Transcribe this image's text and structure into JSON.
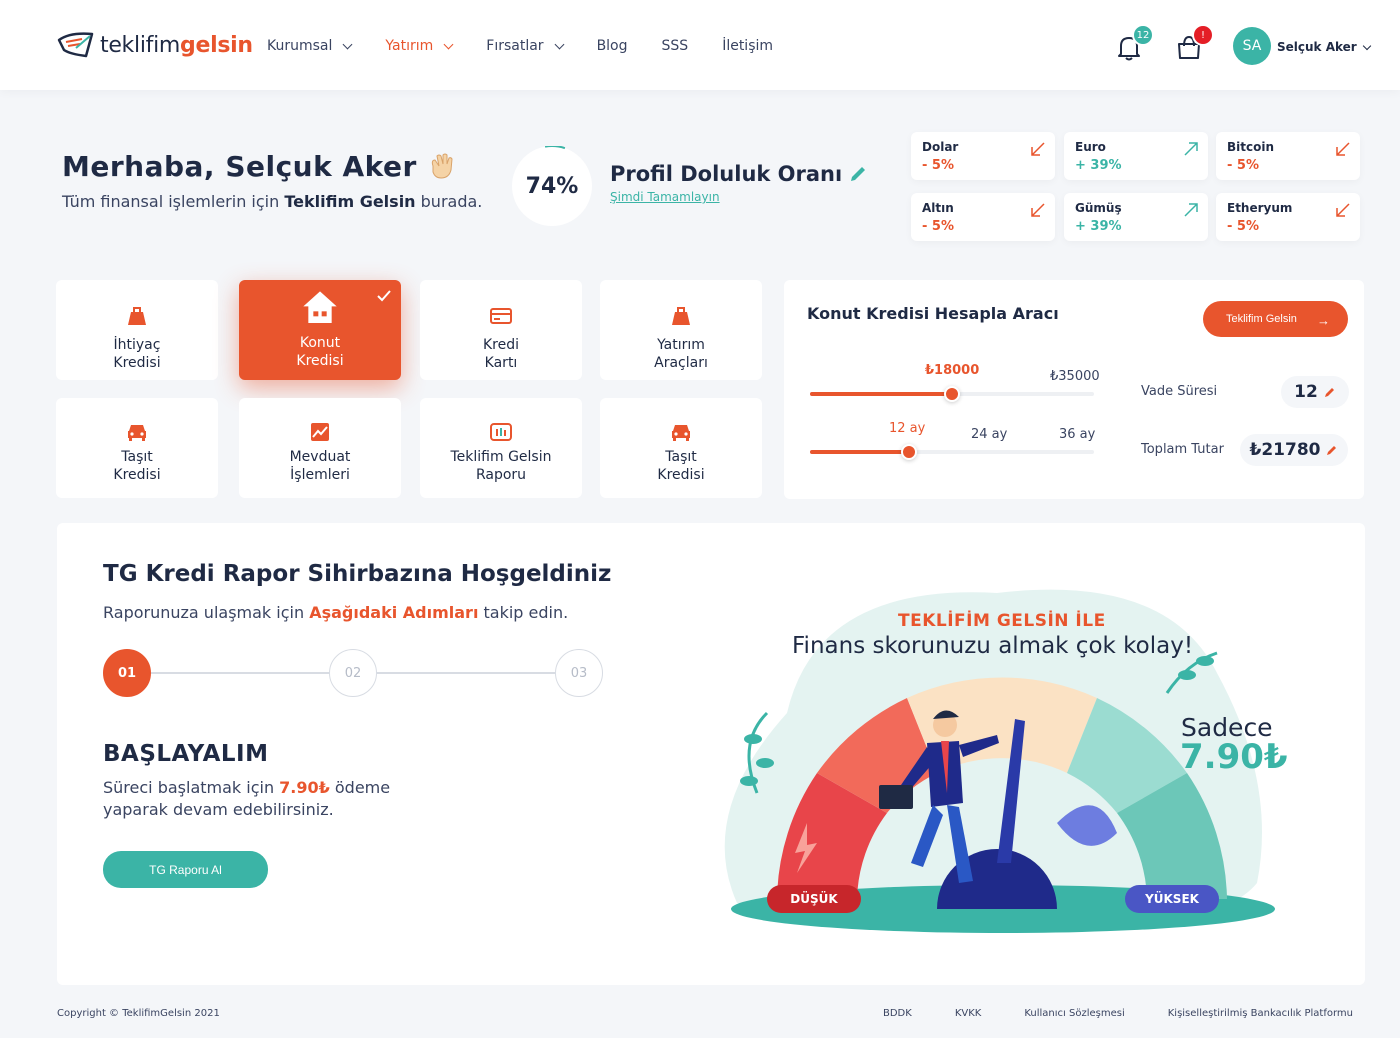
{
  "header": {
    "logo": {
      "part1": "teklifim",
      "part2": "gelsin"
    },
    "nav": [
      {
        "label": "Kurumsal",
        "dropdown": true,
        "active": false
      },
      {
        "label": "Yatırım",
        "dropdown": true,
        "active": true
      },
      {
        "label": "Fırsatlar",
        "dropdown": true,
        "active": false
      },
      {
        "label": "Blog",
        "dropdown": false,
        "active": false
      },
      {
        "label": "SSS",
        "dropdown": false,
        "active": false
      },
      {
        "label": "İletişim",
        "dropdown": false,
        "active": false
      }
    ],
    "notifications_count": "12",
    "cart_badge": "!",
    "user": {
      "initials": "SA",
      "name": "Selçuk Aker"
    }
  },
  "greeting": {
    "title": "Merhaba, Selçuk Aker",
    "sub_pre": "Tüm finansal işlemlerin için ",
    "sub_bold": "Teklifim Gelsin",
    "sub_post": " burada."
  },
  "profile": {
    "percent_label": "74%",
    "percent_value": 0.74,
    "title": "Profil Doluluk Oranı",
    "link": "Şimdi Tamamlayın"
  },
  "rates": [
    {
      "name": "Dolar",
      "value": "- 5%",
      "trend": "down"
    },
    {
      "name": "Euro",
      "value": "+ 39%",
      "trend": "up"
    },
    {
      "name": "Bitcoin",
      "value": "- 5%",
      "trend": "down"
    },
    {
      "name": "Altın",
      "value": "- 5%",
      "trend": "down"
    },
    {
      "name": "Gümüş",
      "value": "+ 39%",
      "trend": "up"
    },
    {
      "name": "Etheryum",
      "value": "- 5%",
      "trend": "down"
    }
  ],
  "services": [
    {
      "line1": "İhtiyaç",
      "line2": "Kredisi",
      "icon": "bag-icon",
      "active": false
    },
    {
      "line1": "Konut",
      "line2": "Kredisi",
      "icon": "house-icon",
      "active": true
    },
    {
      "line1": "Kredi",
      "line2": "Kartı",
      "icon": "credit-card-icon",
      "active": false
    },
    {
      "line1": "Yatırım",
      "line2": "Araçları",
      "icon": "bag-icon",
      "active": false
    },
    {
      "line1": "Taşıt",
      "line2": "Kredisi",
      "icon": "car-icon",
      "active": false
    },
    {
      "line1": "Mevduat",
      "line2": "İşlemleri",
      "icon": "chart-card-icon",
      "active": false
    },
    {
      "line1": "Teklifim Gelsin",
      "line2": "Raporu",
      "icon": "report-icon",
      "active": false
    },
    {
      "line1": "Taşıt",
      "line2": "Kredisi",
      "icon": "car-icon",
      "active": false
    }
  ],
  "calculator": {
    "title": "Konut Kredisi Hesapla Aracı",
    "button": "Teklifim Gelsin",
    "amount_selected": "₺18000",
    "amount_max": "₺35000",
    "amount_fraction": 0.5,
    "term_selected": "12 ay",
    "term_mid": "24 ay",
    "term_max": "36 ay",
    "term_fraction": 0.35,
    "vade_label": "Vade Süresi",
    "vade_value": "12",
    "total_label": "Toplam Tutar",
    "total_value": "₺21780"
  },
  "wizard": {
    "title": "TG Kredi Rapor Sihirbazına Hoşgeldiniz",
    "sub_pre": "Raporunuza ulaşmak için ",
    "sub_bold": "Aşağıdaki Adımları",
    "sub_post": " takip edin.",
    "steps": [
      "01",
      "02",
      "03"
    ],
    "heading": "BAŞLAYALIM",
    "desc_pre": "Süreci başlatmak için ",
    "desc_bold": "7.90₺",
    "desc_post": " ödeme yaparak devam edebilirsiniz.",
    "button": "TG Raporu Al"
  },
  "illustration": {
    "top": "TEKLİFİM GELSİN İLE",
    "main": "Finans skorunuzu almak çok kolay!",
    "sadece": "Sadece",
    "price": "7.90₺",
    "low": "DÜŞÜK",
    "high": "YÜKSEK"
  },
  "footer": {
    "copyright": "Copyright © TeklifimGelsin 2021",
    "links": [
      "BDDK",
      "KVKK",
      "Kullanıcı Sözleşmesi",
      "Kişiselleştirilmiş Bankacılık Platformu"
    ]
  },
  "colors": {
    "accent": "#e8552d",
    "teal": "#3bb4a6",
    "navy": "#1f2a44"
  }
}
